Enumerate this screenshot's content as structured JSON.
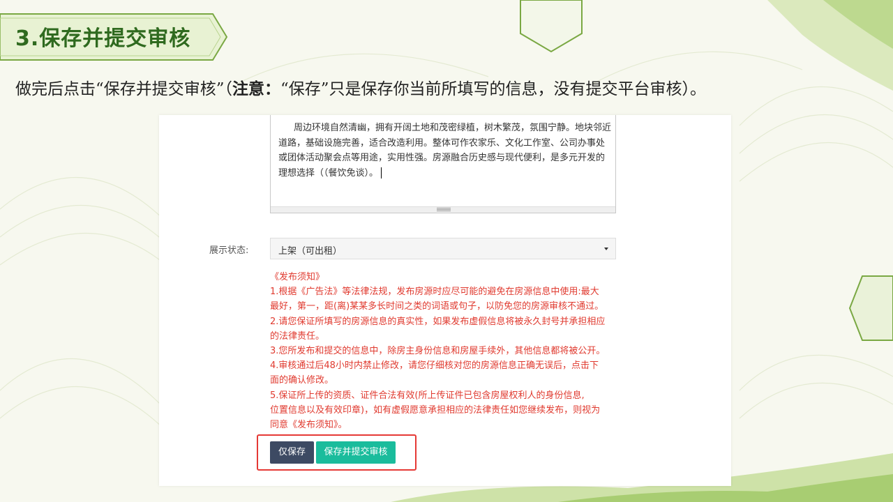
{
  "slide": {
    "title": "3.保存并提交审核",
    "subtitle_pre": "做完后点击“保存并提交审核”（",
    "subtitle_bold": "注意：",
    "subtitle_post": "“保存”只是保存你当前所填写的信息，没有提交平台审核）。"
  },
  "form": {
    "description_text": "周边环境自然清幽，拥有开阔土地和茂密绿植，树木繁茂，氛围宁静。地块邻近道路，基础设施完善，适合改造利用。整体可作农家乐、文化工作室、公司办事处或团体活动聚会点等用途，实用性强。房源融合历史感与现代便利，是多元开发的理想选择（（餐饮免谈）。",
    "status_label": "展示状态:",
    "status_value": "上架（可出租）",
    "notice_lines": [
      "《发布须知》",
      "1.根据《广告法》等法律法规，发布房源时应尽可能的避免在房源信息中使用:最大",
      "最好，第一，距(离)某某多长时间之类的词语或句子，以防免您的房源审核不通过。",
      "2.请您保证所填写的房源信息的真实性，如果发布虚假信息将被永久封号并承担相应",
      "的法律责任。",
      "3.您所发布和提交的信息中，除房主身份信息和房屋手续外，其他信息都将被公开。",
      "4.审核通过后48小时内禁止修改，请您仔细核对您的房源信息正确无误后，点击下",
      "面的确认修改。",
      "5.保证所上传的资质、证件合法有效(所上传证件已包含房屋权利人的身份信息,",
      "位置信息以及有效印章)，如有虚假愿意承担相应的法律责任如您继续发布，则视为",
      "同意《发布须知》。"
    ],
    "save_only_label": "仅保存",
    "save_submit_label": "保存并提交审核"
  },
  "colors": {
    "title_green": "#2f6a1f",
    "notice_red": "#e03a2f",
    "save_button": "#3d4a63",
    "submit_button": "#1abc9c",
    "highlight_box": "#e53935"
  },
  "icons": [
    "dropdown-caret-icon",
    "resize-grip-icon"
  ]
}
